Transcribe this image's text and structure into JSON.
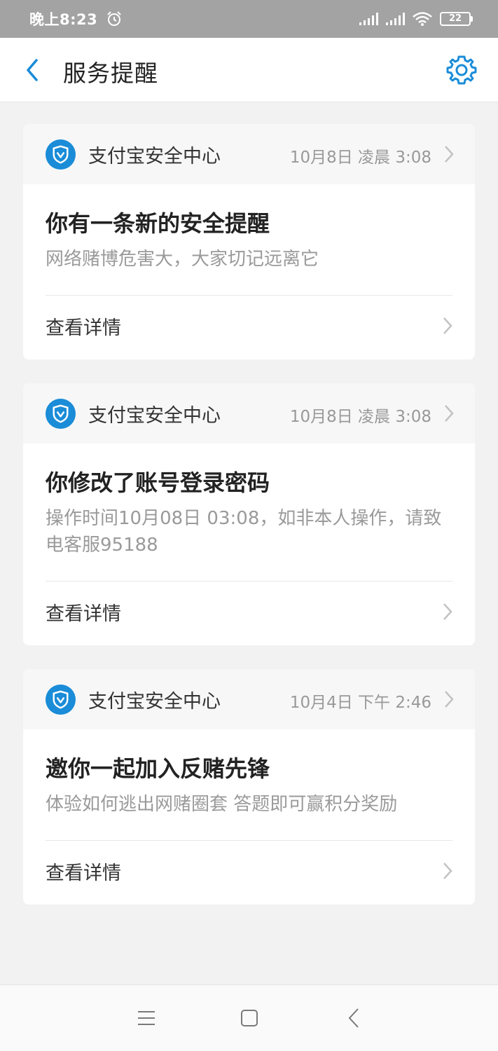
{
  "status_bar": {
    "time": "晚上8:23",
    "battery": "22",
    "icons": [
      "alarm-icon",
      "signal-icon",
      "signal-icon",
      "wifi-icon",
      "battery-icon"
    ]
  },
  "header": {
    "title": "服务提醒",
    "back_icon": "back-chevron-icon",
    "settings_icon": "gear-icon"
  },
  "accent_color": "#1a8cd8",
  "cards": [
    {
      "sender": "支付宝安全中心",
      "time": "10月8日 凌晨 3:08",
      "title": "你有一条新的安全提醒",
      "description": "网络赌博危害大，大家切记远离它",
      "action": "查看详情"
    },
    {
      "sender": "支付宝安全中心",
      "time": "10月8日 凌晨 3:08",
      "title": "你修改了账号登录密码",
      "description": "操作时间10月08日 03:08，如非本人操作，请致电客服95188",
      "action": "查看详情"
    },
    {
      "sender": "支付宝安全中心",
      "time": "10月4日 下午 2:46",
      "title": "邀你一起加入反赌先锋",
      "description": "体验如何逃出网赌圈套 答题即可赢积分奖励",
      "action": "查看详情"
    }
  ],
  "system_nav": {
    "icons": [
      "menu-icon",
      "home-icon",
      "back-icon"
    ]
  }
}
